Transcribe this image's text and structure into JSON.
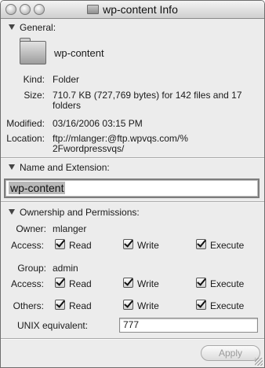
{
  "window": {
    "title": "wp-content Info"
  },
  "general": {
    "header": "General:",
    "name": "wp-content",
    "kind_label": "Kind:",
    "kind_value": "Folder",
    "size_label": "Size:",
    "size_line1": "710.7 KB (727,769 bytes) for 142 files and 17",
    "size_line2": "folders",
    "modified_label": "Modified:",
    "modified_value": "03/16/2006 03:15 PM",
    "location_label": "Location:",
    "location_line1": "ftp://mlanger:@ftp.wpvqs.com/%",
    "location_line2": "2Fwordpressvqs/"
  },
  "name_extension": {
    "header": "Name and Extension:",
    "value": "wp-content"
  },
  "ownership": {
    "header": "Ownership and Permissions:",
    "owner_label": "Owner:",
    "owner_value": "mlanger",
    "group_label": "Group:",
    "group_value": "admin",
    "access_label": "Access:",
    "others_label": "Others:",
    "read_label": "Read",
    "write_label": "Write",
    "execute_label": "Execute",
    "unix_label": "UNIX equivalent:",
    "unix_value": "777",
    "permissions": {
      "owner": {
        "read": true,
        "write": true,
        "execute": true
      },
      "group": {
        "read": true,
        "write": true,
        "execute": true
      },
      "others": {
        "read": true,
        "write": true,
        "execute": true
      }
    }
  },
  "apply_label": "Apply"
}
